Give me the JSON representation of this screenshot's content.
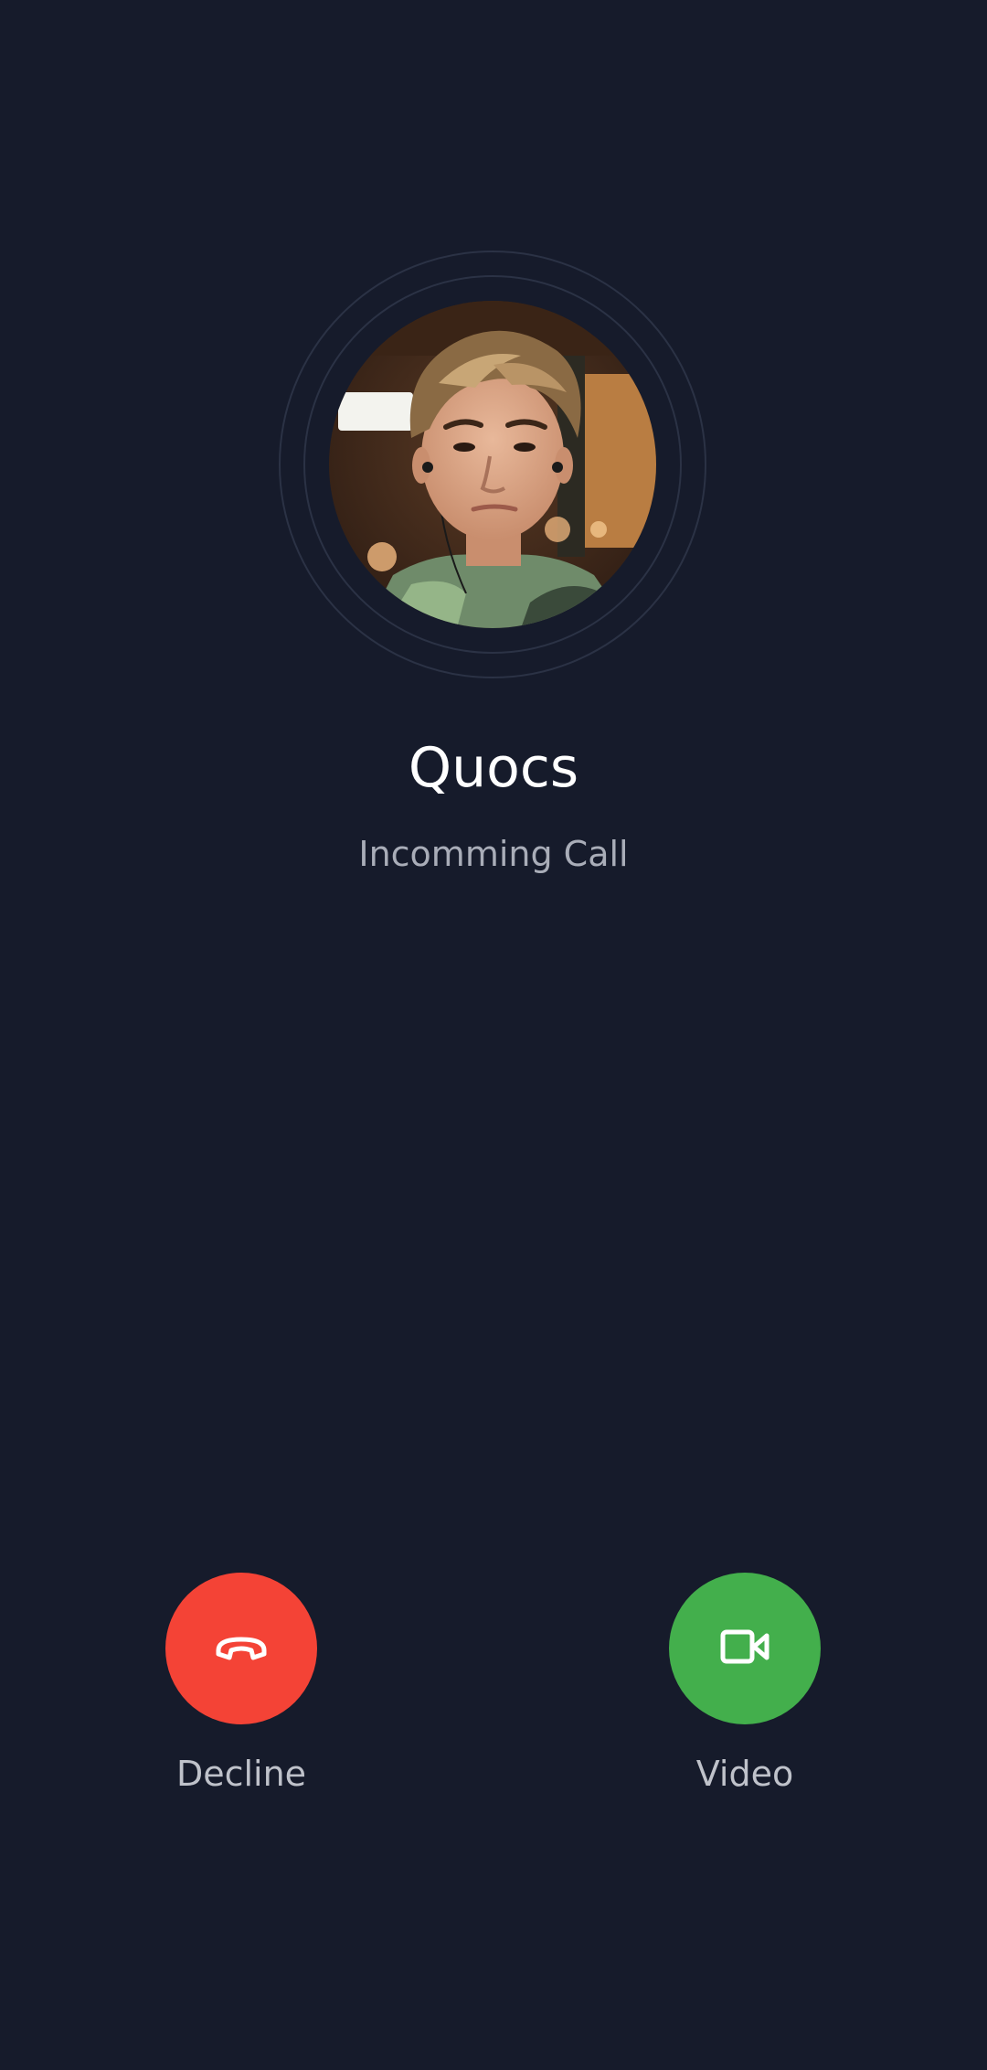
{
  "call": {
    "caller_name": "Quocs",
    "status": "Incomming Call"
  },
  "actions": {
    "decline_label": "Decline",
    "video_label": "Video"
  },
  "icons": {
    "decline": "phone-hangup-icon",
    "video": "video-camera-icon"
  },
  "colors": {
    "background": "#161b2b",
    "decline": "#f44336",
    "accept_video": "#43af4c",
    "ring": "#2b3245"
  }
}
